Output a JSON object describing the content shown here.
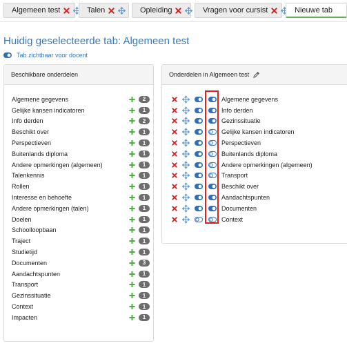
{
  "tabs": [
    {
      "label": "Algemeen test",
      "closable": true,
      "movable": true
    },
    {
      "label": "Talen",
      "closable": true,
      "movable": true
    },
    {
      "label": "Opleiding",
      "closable": true,
      "movable": true
    },
    {
      "label": "Vragen voor cursist",
      "closable": true,
      "movable": true
    },
    {
      "label": "Nieuwe tab",
      "closable": false,
      "movable": false
    }
  ],
  "heading": {
    "title": "Huidig geselecteerde tab: Algemeen test",
    "visibility_label": "Tab zichtbaar voor docent",
    "visibility_on": true
  },
  "available_panel": {
    "title": "Beschikbare onderdelen",
    "items": [
      {
        "name": "Algemene gegevens",
        "count": "2"
      },
      {
        "name": "Gelijke kansen indicatoren",
        "count": "1"
      },
      {
        "name": "Info derden",
        "count": "2"
      },
      {
        "name": "Beschikt over",
        "count": "1"
      },
      {
        "name": "Perspectieven",
        "count": "1"
      },
      {
        "name": "Buitenlands diploma",
        "count": "1"
      },
      {
        "name": "Andere opmerkingen (algemeen)",
        "count": "1"
      },
      {
        "name": "Talenkennis",
        "count": "1"
      },
      {
        "name": "Rollen",
        "count": "1"
      },
      {
        "name": "Interesse en behoefte",
        "count": "1"
      },
      {
        "name": "Andere opmerkingen (talen)",
        "count": "1"
      },
      {
        "name": "Doelen",
        "count": "1"
      },
      {
        "name": "Schoolloopbaan",
        "count": "1"
      },
      {
        "name": "Traject",
        "count": "1"
      },
      {
        "name": "Studietijd",
        "count": "1"
      },
      {
        "name": "Documenten",
        "count": "3"
      },
      {
        "name": "Aandachtspunten",
        "count": "1"
      },
      {
        "name": "Transport",
        "count": "1"
      },
      {
        "name": "Gezinssituatie",
        "count": "1"
      },
      {
        "name": "Context",
        "count": "1"
      },
      {
        "name": "Impacten",
        "count": "1"
      }
    ]
  },
  "tab_panel": {
    "title": "Onderdelen in Algemeen test",
    "items": [
      {
        "name": "Algemene gegevens",
        "toggle_a": true,
        "toggle_b": true
      },
      {
        "name": "Info derden",
        "toggle_a": true,
        "toggle_b": true
      },
      {
        "name": "Gezinssituatie",
        "toggle_a": true,
        "toggle_b": true
      },
      {
        "name": "Gelijke kansen indicatoren",
        "toggle_a": true,
        "toggle_b": false
      },
      {
        "name": "Perspectieven",
        "toggle_a": true,
        "toggle_b": false
      },
      {
        "name": "Buitenlands diploma",
        "toggle_a": true,
        "toggle_b": false
      },
      {
        "name": "Andere opmerkingen (algemeen)",
        "toggle_a": true,
        "toggle_b": false
      },
      {
        "name": "Transport",
        "toggle_a": true,
        "toggle_b": false
      },
      {
        "name": "Beschikt over",
        "toggle_a": true,
        "toggle_b": true
      },
      {
        "name": "Aandachtspunten",
        "toggle_a": true,
        "toggle_b": true
      },
      {
        "name": "Documenten",
        "toggle_a": true,
        "toggle_b": true
      },
      {
        "name": "Context",
        "toggle_a": false,
        "toggle_b": false
      }
    ]
  },
  "colors": {
    "accent_blue": "#3a78bb",
    "delete_red": "#d32020",
    "add_green": "#4cae3f",
    "badge_gray": "#6d6d6d",
    "highlight_red": "#e01f1f"
  },
  "icons": {
    "close": "close-icon",
    "move": "move-icon",
    "add": "plus-icon",
    "edit": "pencil-icon",
    "toggle": "toggle-icon"
  }
}
